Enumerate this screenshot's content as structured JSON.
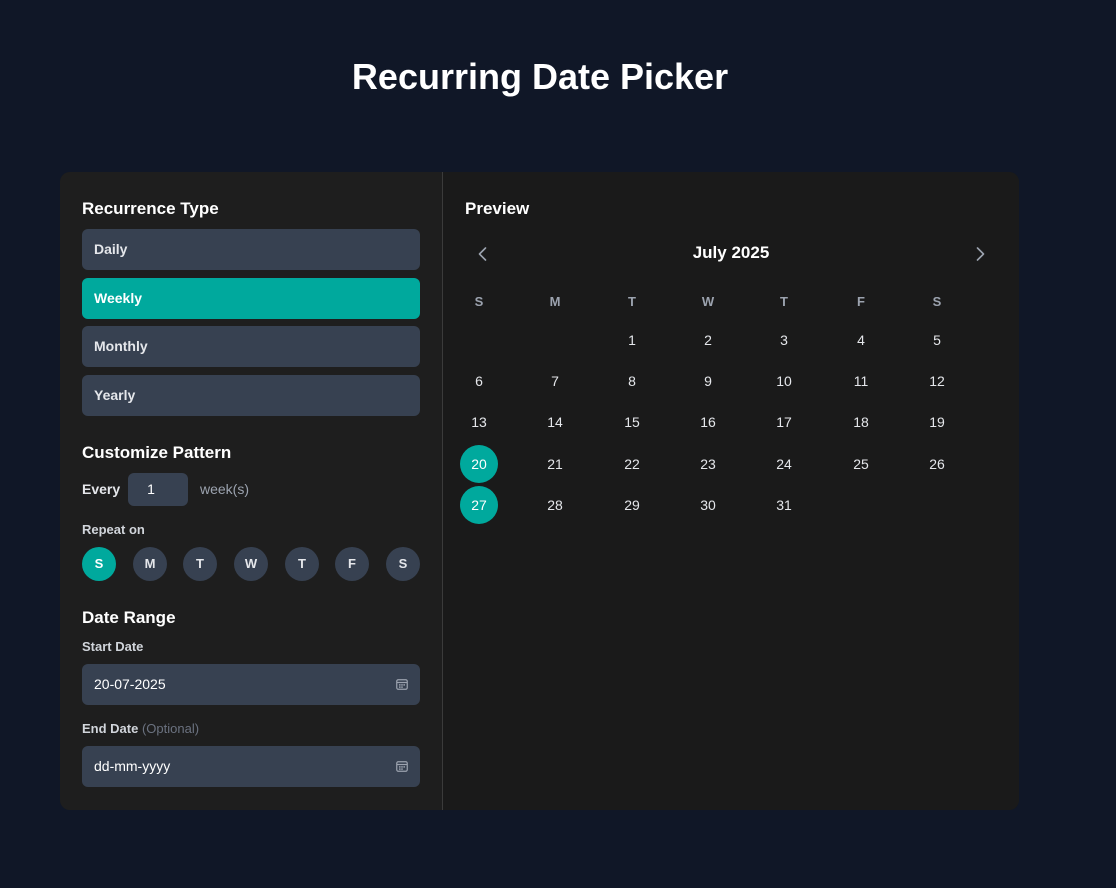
{
  "page": {
    "title": "Recurring Date Picker"
  },
  "recurrence": {
    "heading": "Recurrence Type",
    "options": [
      "Daily",
      "Weekly",
      "Monthly",
      "Yearly"
    ],
    "selected": "Weekly"
  },
  "pattern": {
    "heading": "Customize Pattern",
    "every_label": "Every",
    "every_value": "1",
    "unit": "week(s)",
    "repeat_on_label": "Repeat on",
    "days": [
      "S",
      "M",
      "T",
      "W",
      "T",
      "F",
      "S"
    ],
    "selected_days": [
      "Sunday"
    ]
  },
  "date_range": {
    "heading": "Date Range",
    "start_label": "Start Date",
    "start_value": "20-07-2025",
    "end_label": "End Date",
    "end_optional": "(Optional)",
    "end_value": "dd-mm-yyyy"
  },
  "preview": {
    "heading": "Preview",
    "month_label": "July 2025",
    "weekdays": [
      "S",
      "M",
      "T",
      "W",
      "T",
      "F",
      "S"
    ],
    "weeks": [
      [
        "",
        "",
        "1",
        "2",
        "3",
        "4",
        "5"
      ],
      [
        "6",
        "7",
        "8",
        "9",
        "10",
        "11",
        "12"
      ],
      [
        "13",
        "14",
        "15",
        "16",
        "17",
        "18",
        "19"
      ],
      [
        "20",
        "21",
        "22",
        "23",
        "24",
        "25",
        "26"
      ],
      [
        "27",
        "28",
        "29",
        "30",
        "31",
        "",
        ""
      ]
    ],
    "highlighted_days": [
      "20",
      "27"
    ]
  },
  "icons": {
    "prev": "chevron-left-icon",
    "next": "chevron-right-icon",
    "calendar": "calendar-icon"
  },
  "colors": {
    "background": "#101727",
    "panel": "#1e1e1e",
    "accent": "#00a99d",
    "control": "#374151"
  }
}
